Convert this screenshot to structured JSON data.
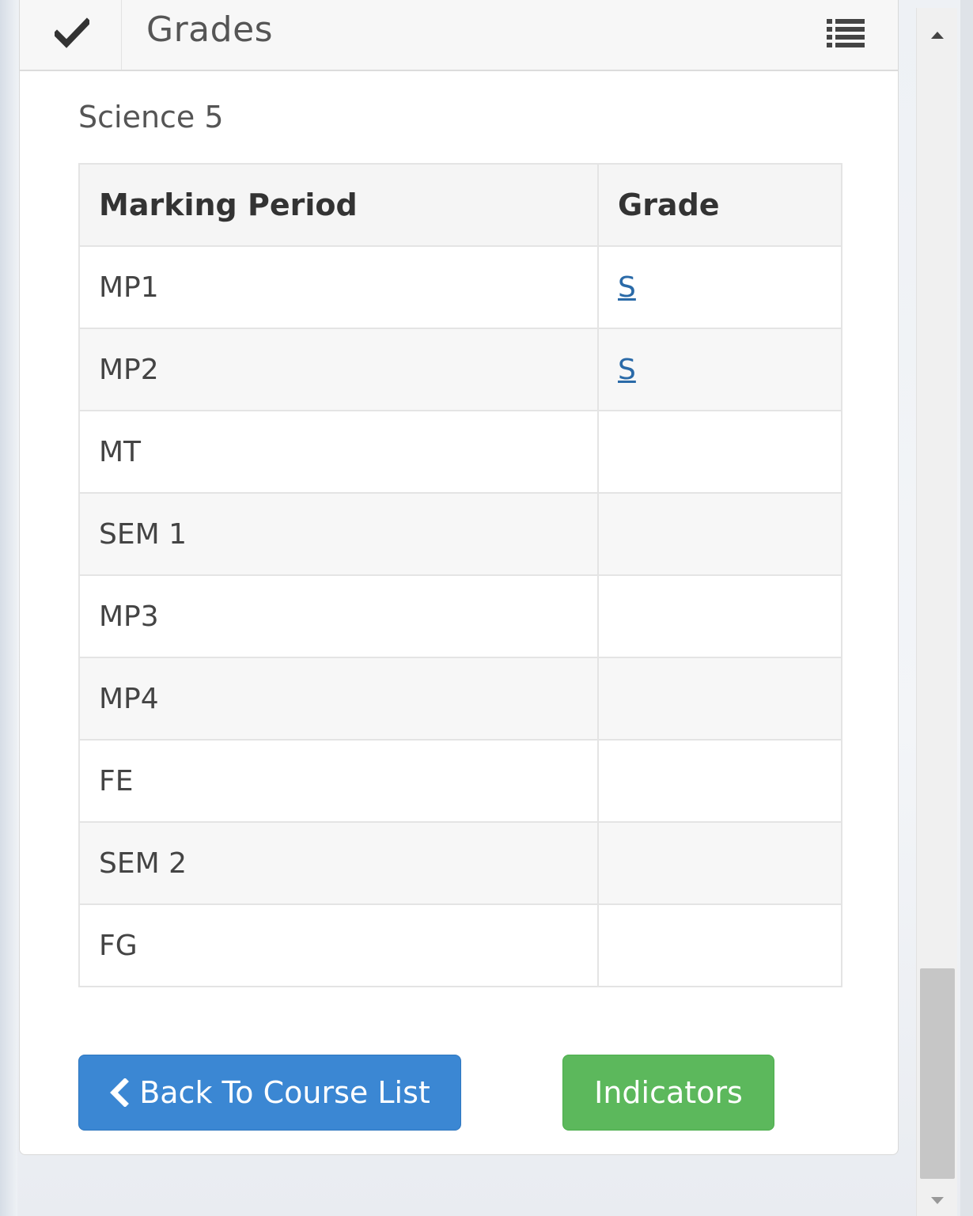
{
  "header": {
    "title": "Grades",
    "check_icon": "check-icon",
    "menu_icon": "list-icon"
  },
  "course": {
    "title": "Science 5"
  },
  "table": {
    "columns": [
      "Marking Period",
      "Grade"
    ],
    "rows": [
      {
        "period": "MP1",
        "grade": "S",
        "grade_is_link": true
      },
      {
        "period": "MP2",
        "grade": "S",
        "grade_is_link": true
      },
      {
        "period": "MT",
        "grade": ""
      },
      {
        "period": "SEM 1",
        "grade": ""
      },
      {
        "period": "MP3",
        "grade": ""
      },
      {
        "period": "MP4",
        "grade": ""
      },
      {
        "period": "FE",
        "grade": ""
      },
      {
        "period": "SEM 2",
        "grade": ""
      },
      {
        "period": "FG",
        "grade": ""
      }
    ]
  },
  "buttons": {
    "back_label": "Back To Course List",
    "indicators_label": "Indicators"
  },
  "colors": {
    "primary": "#3b87d3",
    "success": "#5cb85c",
    "link": "#2a6aa8"
  }
}
